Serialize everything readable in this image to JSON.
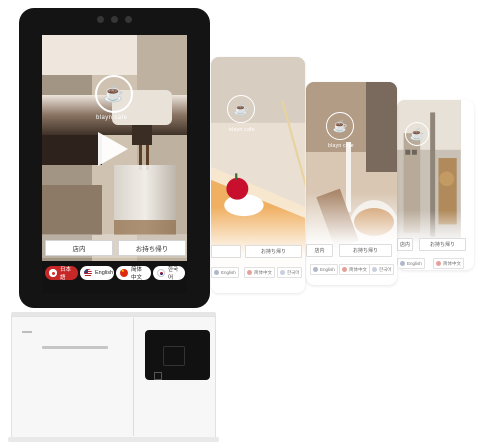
{
  "brand": {
    "logo_icon": "coffee-cup-icon",
    "name": "blayn cafe"
  },
  "main_screen": {
    "play_icon": "play-icon",
    "order_buttons": [
      {
        "label": "店内"
      },
      {
        "label": "お持ち帰り"
      }
    ],
    "languages": [
      {
        "label": "日本語",
        "flag": "japan-flag-icon",
        "selected": true
      },
      {
        "label": "English",
        "flag": "usa-flag-icon",
        "selected": false
      },
      {
        "label": "简体中文",
        "flag": "china-flag-icon",
        "selected": false
      },
      {
        "label": "한국어",
        "flag": "korea-flag-icon",
        "selected": false
      }
    ]
  },
  "preview_screens": [
    {
      "theme": "cake",
      "brand_name": "blayn cafe",
      "order_button": "お持ち帰り",
      "languages": [
        "English",
        "简体中文",
        "한국어"
      ]
    },
    {
      "theme": "latte",
      "brand_name": "blayn cafe",
      "order_buttons": [
        "店内",
        "お持ち帰り"
      ],
      "languages": [
        "English",
        "简体中文",
        "한국어"
      ]
    },
    {
      "theme": "street",
      "order_buttons": [
        "店内",
        "お持ち帰り"
      ],
      "languages": [
        "English",
        "简体中文"
      ]
    }
  ],
  "colors": {
    "bezel": "#141414",
    "selected_language_bg": "#c62828",
    "japan_red": "#d32f2f",
    "china_red": "#de2910"
  }
}
